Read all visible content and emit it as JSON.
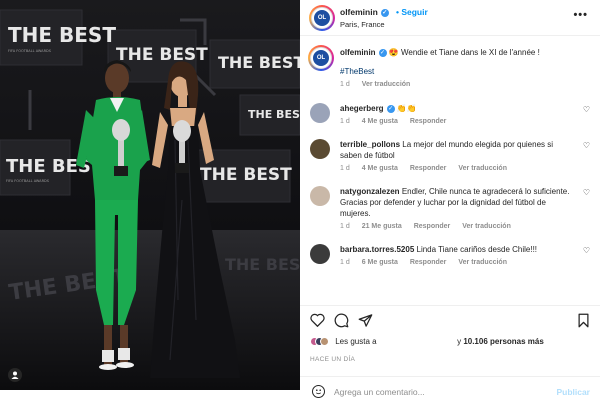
{
  "post": {
    "username": "olfeminin",
    "follow_label": "Seguir",
    "location": "Paris, France",
    "avatar_text": "OL",
    "caption": "😍 Wendie et Tiane dans le XI de l'année !",
    "hashtag": "#TheBest",
    "caption_time": "1 d",
    "caption_translate": "Ver traducción"
  },
  "photo": {
    "backdrop_text": "THE BEST",
    "backdrop_sub": "FIFA FOOTBALL AWARDS",
    "floor_text": "THE BEST"
  },
  "comments": [
    {
      "user": "ahegerberg",
      "verified": true,
      "text": "👏👏",
      "time": "1 d",
      "likes": "4 Me gusta",
      "reply": "Responder",
      "translate": "",
      "color": "#9aa3b8"
    },
    {
      "user": "terrible_pollons",
      "verified": false,
      "text": "La mejor del mundo elegida por quienes si saben de fútbol",
      "time": "1 d",
      "likes": "4 Me gusta",
      "reply": "Responder",
      "translate": "Ver traducción",
      "color": "#5a4a32"
    },
    {
      "user": "natygonzalezen",
      "verified": false,
      "text": "Endler, Chile nunca te agradecerá lo suficiente. Gracias por defender y luchar por la dignidad del fútbol de mujeres.",
      "time": "1 d",
      "likes": "21 Me gusta",
      "reply": "Responder",
      "translate": "Ver traducción",
      "color": "#c9b8a8"
    },
    {
      "user": "barbara.torres.5205",
      "verified": false,
      "text": "Linda Tiane cariños desde Chile!!!",
      "time": "1 d",
      "likes": "6 Me gusta",
      "reply": "Responder",
      "translate": "Ver traducción",
      "color": "#3b3b3b"
    }
  ],
  "likes_summary": {
    "prefix": "Les gusta a",
    "middle": "y",
    "count": "10.106 personas más"
  },
  "posted_ago": "HACE UN DÍA",
  "composer": {
    "placeholder": "Agrega un comentario...",
    "publish_label": "Publicar"
  },
  "colors": {
    "link_blue": "#0095f6",
    "publish_disabled": "#b2dffc",
    "hashtag": "#00376b",
    "meta_gray": "#8e8e8e"
  },
  "icons": [
    "more-icon",
    "heart-icon",
    "comment-icon",
    "share-icon",
    "bookmark-icon",
    "emoji-icon",
    "user-tag-icon",
    "verified-icon"
  ]
}
